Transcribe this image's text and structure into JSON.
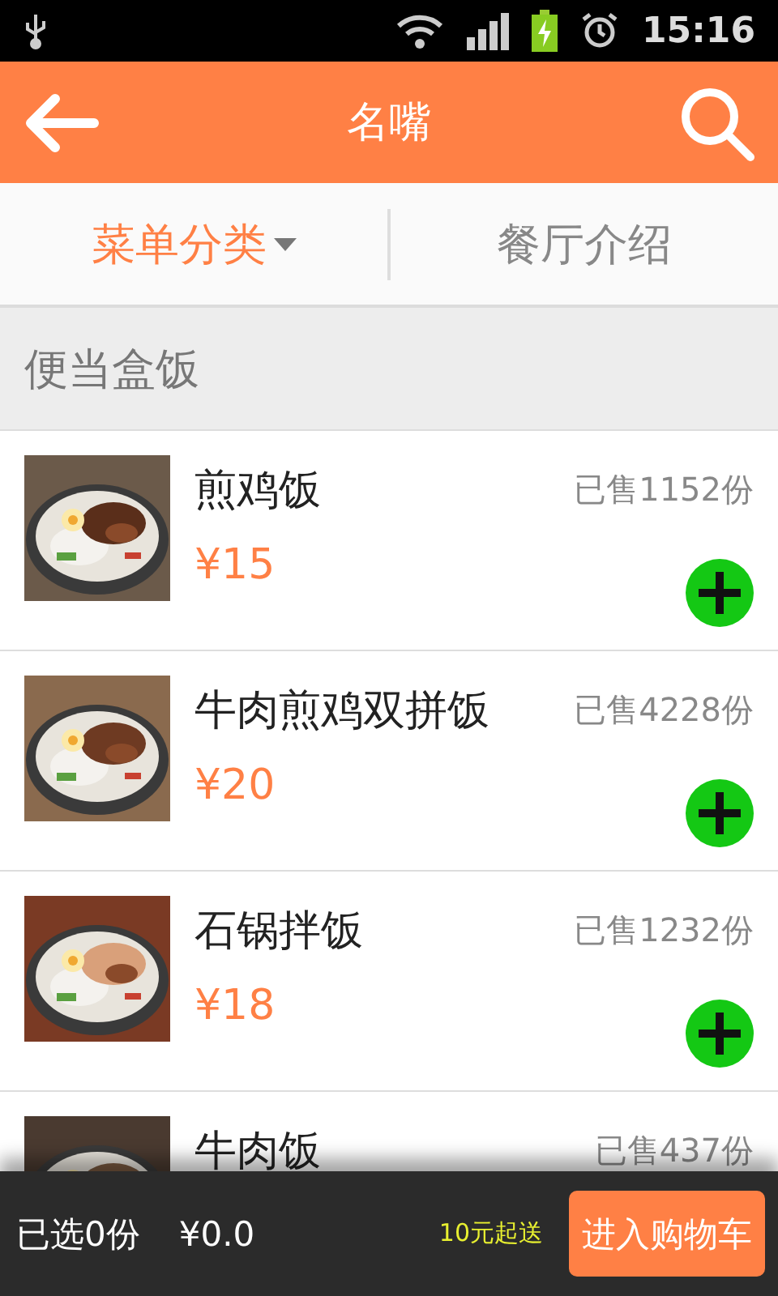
{
  "status_bar": {
    "time": "15:16"
  },
  "header": {
    "title": "名嘴"
  },
  "tabs": [
    {
      "label": "菜单分类",
      "selected": true,
      "dropdown": true
    },
    {
      "label": "餐厅介绍",
      "selected": false,
      "dropdown": false
    }
  ],
  "section": {
    "title": "便当盒饭"
  },
  "dishes": [
    {
      "name": "煎鸡饭",
      "sold": "已售1152份",
      "price": "¥15"
    },
    {
      "name": "牛肉煎鸡双拼饭",
      "sold": "已售4228份",
      "price": "¥20"
    },
    {
      "name": "石锅拌饭",
      "sold": "已售1232份",
      "price": "¥18"
    },
    {
      "name": "牛肉饭",
      "sold": "已售437份"
    }
  ],
  "cart_bar": {
    "selected_count": "已选0份",
    "total": "¥0.0",
    "minimum": "10元起送",
    "button": "进入购物车"
  }
}
